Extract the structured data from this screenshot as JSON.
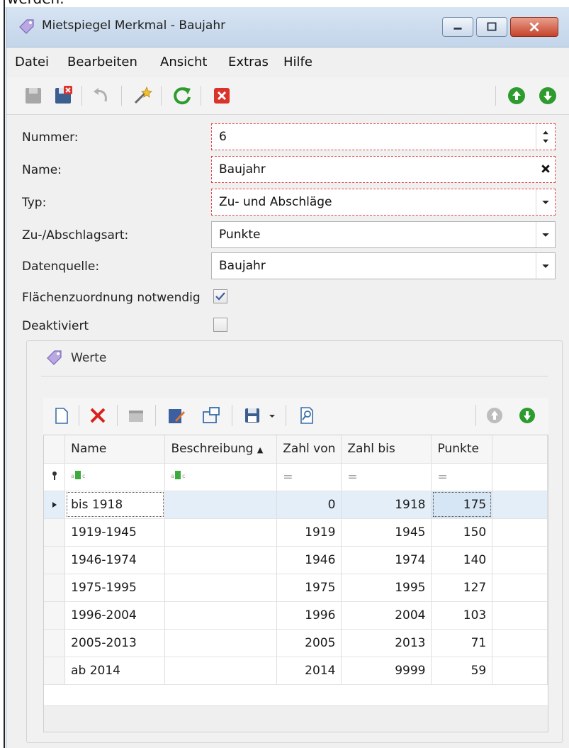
{
  "caption": "werden.",
  "window": {
    "title": "Mietspiegel Merkmal - Baujahr"
  },
  "menu": [
    "Datei",
    "Bearbeiten",
    "Ansicht",
    "Extras",
    "Hilfe"
  ],
  "form": {
    "nummer": {
      "label": "Nummer:",
      "value": "6"
    },
    "name": {
      "label": "Name:",
      "value": "Baujahr"
    },
    "typ": {
      "label": "Typ:",
      "value": "Zu- und Abschläge"
    },
    "abschlagsart": {
      "label": "Zu-/Abschlagsart:",
      "value": "Punkte"
    },
    "datenquelle": {
      "label": "Datenquelle:",
      "value": "Baujahr"
    },
    "flaechen": {
      "label": "Flächenzuordnung notwendig",
      "checked": true
    },
    "deaktiviert": {
      "label": "Deaktiviert",
      "checked": false
    }
  },
  "group": {
    "title": "Werte"
  },
  "grid": {
    "columns": [
      "Name",
      "Beschreibung",
      "Zahl von",
      "Zahl bis",
      "Punkte"
    ],
    "sort_indicator": "▲",
    "filter_text_icon": "text-filter-icon",
    "filter_eq": "=",
    "rows": [
      {
        "name": "bis 1918",
        "beschreibung": "",
        "von": "0",
        "bis": "1918",
        "punkte": "175"
      },
      {
        "name": "1919-1945",
        "beschreibung": "",
        "von": "1919",
        "bis": "1945",
        "punkte": "150"
      },
      {
        "name": "1946-1974",
        "beschreibung": "",
        "von": "1946",
        "bis": "1974",
        "punkte": "140"
      },
      {
        "name": "1975-1995",
        "beschreibung": "",
        "von": "1975",
        "bis": "1995",
        "punkte": "127"
      },
      {
        "name": "1996-2004",
        "beschreibung": "",
        "von": "1996",
        "bis": "2004",
        "punkte": "103"
      },
      {
        "name": "2005-2013",
        "beschreibung": "",
        "von": "2005",
        "bis": "2013",
        "punkte": "71"
      },
      {
        "name": "ab 2014",
        "beschreibung": "",
        "von": "2014",
        "bis": "9999",
        "punkte": "59"
      }
    ]
  },
  "colors": {
    "accent_green": "#2e9b2e",
    "required_border": "#e04646",
    "close_button": "#c6432b"
  }
}
